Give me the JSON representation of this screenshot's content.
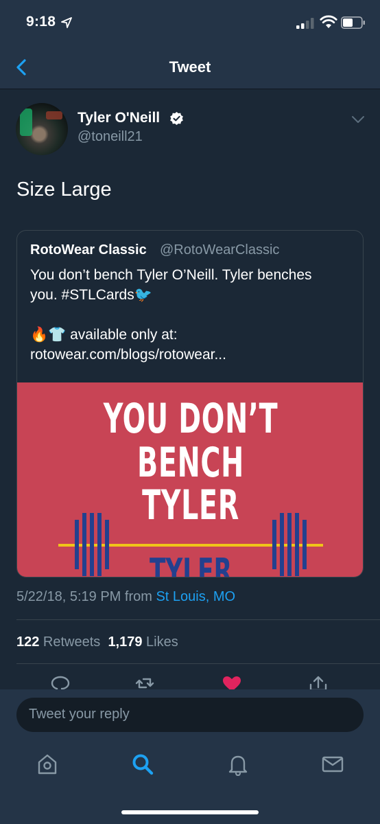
{
  "status_bar": {
    "time": "9:18"
  },
  "nav": {
    "title": "Tweet"
  },
  "tweet": {
    "author_name": "Tyler O'Neill",
    "author_handle": "@toneill21",
    "text": "Size Large",
    "quoted": {
      "name": "RotoWear Classic",
      "handle": "@RotoWearClassic",
      "lines": [
        "You don’t bench Tyler O’Neill. Tyler benches",
        "you. #STLCards🐦",
        "",
        "🔥👕 available only at:",
        "rotowear.com/blogs/rotowear..."
      ],
      "image_text": [
        "YOU DON’T",
        "BENCH",
        "TYLER",
        "TYLER"
      ]
    },
    "timestamp": "5/22/18, 5:19 PM from ",
    "location": "St Louis, MO",
    "retweets_count": "122",
    "retweets_label": " Retweets",
    "likes_count": "1,179",
    "likes_label": " Likes"
  },
  "reply": {
    "placeholder": "Tweet your reply"
  },
  "icons": {
    "reply": "reply-icon",
    "retweet": "retweet-icon",
    "like": "heart-icon",
    "share": "share-icon",
    "home": "home-icon",
    "search": "search-icon",
    "notifications": "bell-icon",
    "messages": "mail-icon"
  },
  "colors": {
    "accent": "#1da1f2",
    "like": "#e0245e",
    "background": "#141d26",
    "card": "#1b2836",
    "bar": "#243447"
  }
}
